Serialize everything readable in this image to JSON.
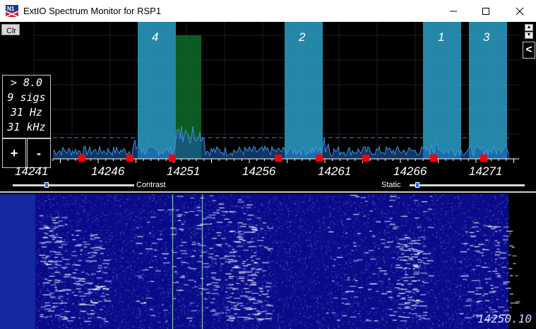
{
  "window": {
    "title": "ExtIO Spectrum Monitor for RSP1",
    "minimize_glyph": "—",
    "maximize_glyph": "☐",
    "close_glyph": "✕"
  },
  "controls": {
    "clear_label": "Clr",
    "plus_label": "+",
    "minus_label": "-",
    "collapse_label": "<",
    "scroll_up_glyph": "▲",
    "scroll_down_glyph": "▼"
  },
  "stats": {
    "threshold": "> 8.0",
    "signals": "9 sigs",
    "resolution": "31 Hz",
    "bandwidth": "31 kHz"
  },
  "freq_axis": {
    "labels": [
      "14241",
      "14246",
      "14251",
      "14256",
      "14261",
      "14266",
      "14271"
    ]
  },
  "bands": {
    "labels": [
      "4",
      "2",
      "1",
      "3"
    ]
  },
  "sliders": {
    "contrast_label": "Contrast",
    "static_label": "Static",
    "contrast_value": 0.28,
    "static_value": 0.07
  },
  "waterfall": {
    "cursor_frequency": "14250.10"
  },
  "colors": {
    "band_fill": "#2a9fc4",
    "selected_band": "#0f6b2a",
    "spectrum_trace": "#4aa8f0",
    "signal_marker": "#ff0000",
    "waterfall_bg": "#0a0a88"
  },
  "icons": {
    "app_icon": "n1-app-icon"
  }
}
